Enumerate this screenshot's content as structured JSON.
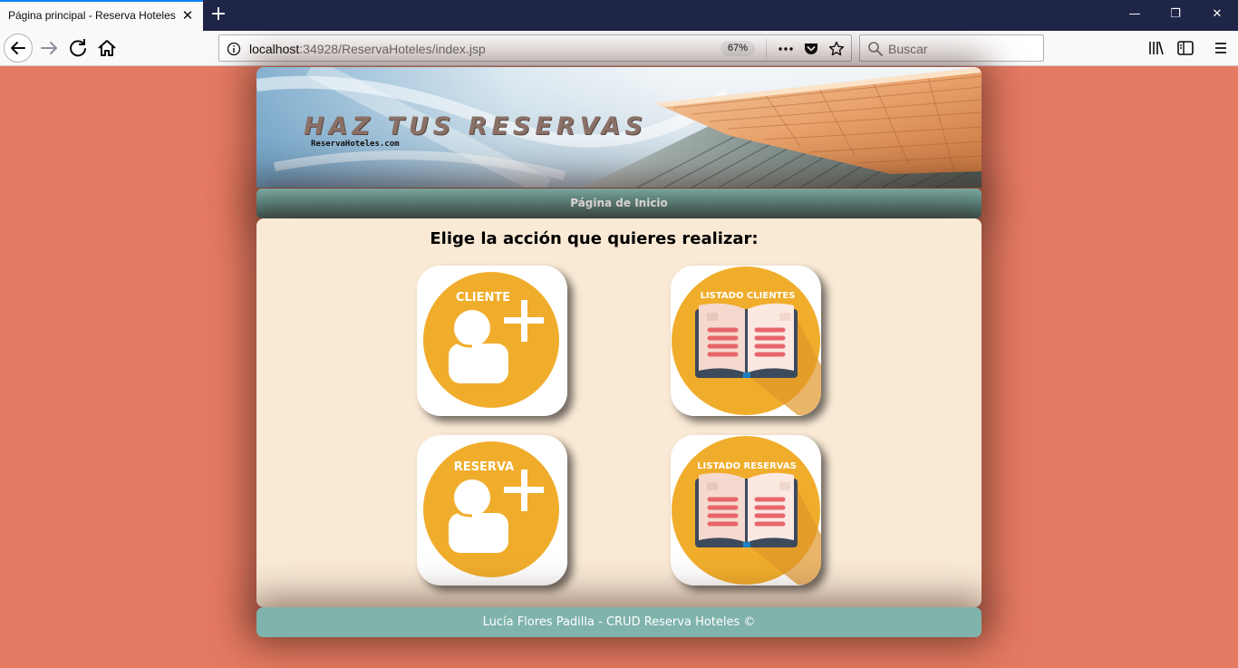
{
  "browser": {
    "tab_title": "Página principal - Reserva Hoteles",
    "tab_close": "✕",
    "new_tab": "+",
    "window_controls": {
      "minimize": "—",
      "restore": "❐",
      "close": "✕"
    },
    "url_host": "localhost",
    "url_rest": ":34928/ReservaHoteles/index.jsp",
    "zoom": "67%",
    "search_placeholder": "Buscar"
  },
  "header": {
    "title": "HAZ TUS RESERVAS",
    "subtitle": "ReservaHoteles.com"
  },
  "menu": {
    "home_link": "Página de Inicio"
  },
  "main": {
    "heading": "Elige la acción que quieres realizar:",
    "actions": [
      {
        "label": "CLIENTE",
        "icon": "add-user-icon"
      },
      {
        "label": "LISTADO CLIENTES",
        "icon": "open-book-icon"
      },
      {
        "label": "RESERVA",
        "icon": "add-user-icon"
      },
      {
        "label": "LISTADO RESERVAS",
        "icon": "open-book-icon"
      }
    ]
  },
  "footer": {
    "text": "Lucía Flores Padilla - CRUD Reserva Hoteles ©"
  },
  "colors": {
    "page_bg": "#e57a62",
    "content_bg": "#f9e9d5",
    "menu_teal": "#5f8e88",
    "footer_teal": "#7fb3ab",
    "icon_orange": "#f0ad2c",
    "book_stripe": "#e8656a"
  }
}
